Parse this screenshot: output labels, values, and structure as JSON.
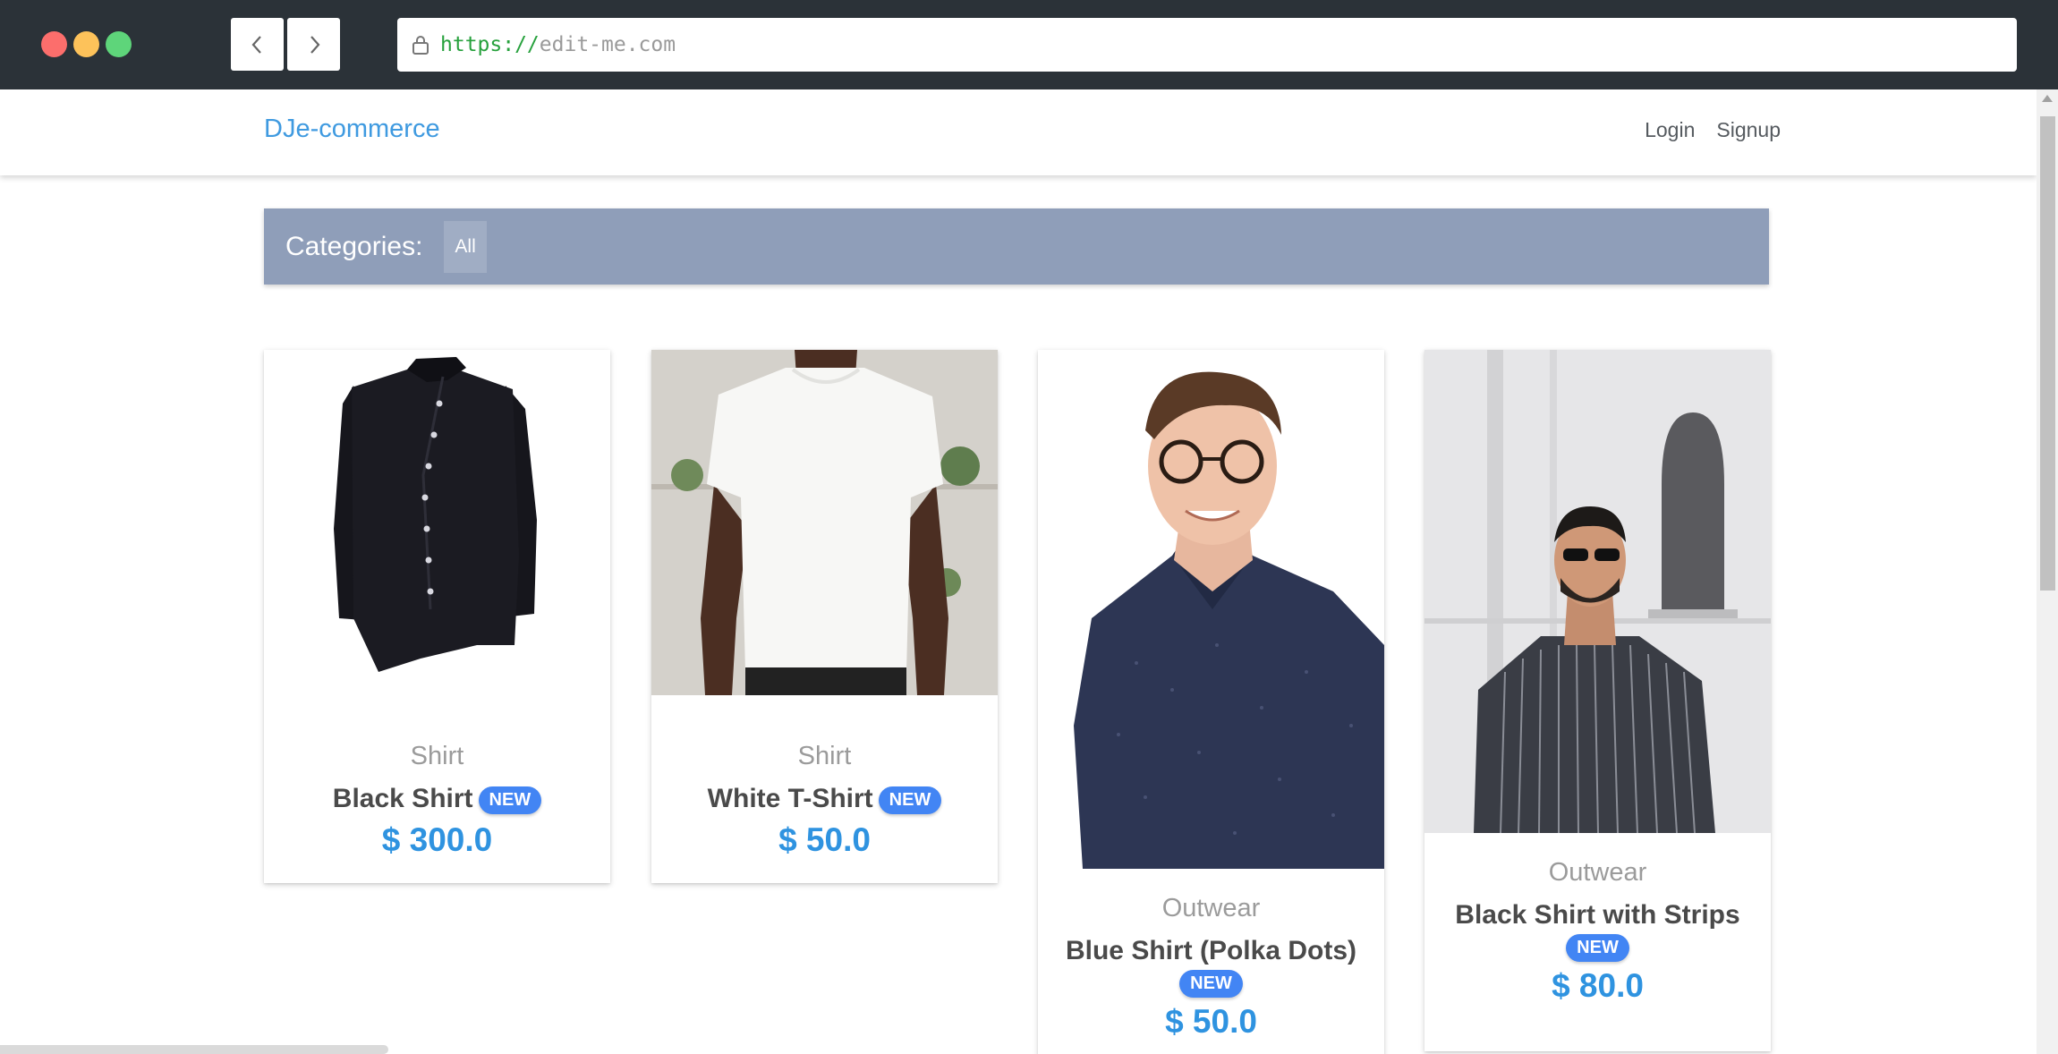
{
  "browser": {
    "url_protocol": "https://",
    "url_host": "edit-me.com"
  },
  "header": {
    "brand": "DJe-commerce",
    "links": [
      "Login",
      "Signup"
    ]
  },
  "categories": {
    "label": "Categories:",
    "items": [
      "All"
    ]
  },
  "products": [
    {
      "category": "Shirt",
      "title": "Black Shirt",
      "badge": "NEW",
      "price": "$ 300.0"
    },
    {
      "category": "Shirt",
      "title": "White T-Shirt",
      "badge": "NEW",
      "price": "$ 50.0"
    },
    {
      "category": "Outwear",
      "title": "Blue Shirt (Polka Dots)",
      "badge": "NEW",
      "price": "$ 50.0"
    },
    {
      "category": "Outwear",
      "title": "Black Shirt with Strips",
      "badge": "NEW",
      "price": "$ 80.0"
    }
  ],
  "colors": {
    "brand": "#3f9ae0",
    "category_bar": "#8f9eb9",
    "badge": "#4285f4",
    "price": "#2f93e0"
  },
  "icons": [
    "back-arrow-icon",
    "forward-arrow-icon",
    "lock-icon"
  ]
}
